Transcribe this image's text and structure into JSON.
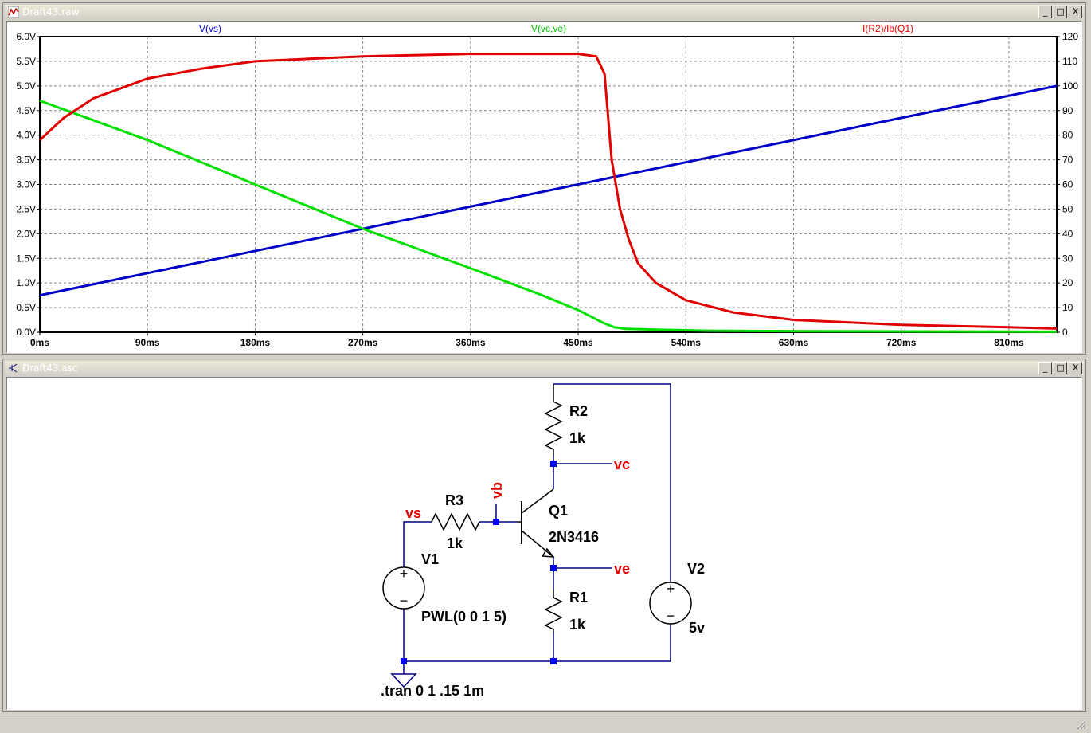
{
  "plot_window": {
    "title": "Draft43.raw",
    "icon": "waveform-icon",
    "controls": {
      "minimize": "_",
      "maximize": "□",
      "close": "X"
    },
    "traces": [
      {
        "label": "V(vs)",
        "color": "#0000c8"
      },
      {
        "label": "V(vc,ve)",
        "color": "#00e000"
      },
      {
        "label": "I(R2)/Ib(Q1)",
        "color": "#e00000"
      }
    ]
  },
  "chart_data": {
    "type": "line",
    "x_unit": "ms",
    "xlim": [
      0,
      850
    ],
    "x_ticks": [
      "0ms",
      "90ms",
      "180ms",
      "270ms",
      "360ms",
      "450ms",
      "540ms",
      "630ms",
      "720ms",
      "810ms"
    ],
    "y_left_ticks": [
      "0.0V",
      "0.5V",
      "1.0V",
      "1.5V",
      "2.0V",
      "2.5V",
      "3.0V",
      "3.5V",
      "4.0V",
      "4.5V",
      "5.0V",
      "5.5V",
      "6.0V"
    ],
    "y_left_lim": [
      0,
      6
    ],
    "y_right_ticks": [
      "0",
      "10",
      "20",
      "30",
      "40",
      "50",
      "60",
      "70",
      "80",
      "90",
      "100",
      "110",
      "120"
    ],
    "y_right_lim": [
      0,
      120
    ],
    "grid": true,
    "series": [
      {
        "name": "V(vs)",
        "axis": "left",
        "color": "#0000c8",
        "x": [
          0,
          850
        ],
        "y": [
          0.75,
          5.0
        ]
      },
      {
        "name": "V(vc,ve)",
        "axis": "left",
        "color": "#00e000",
        "x": [
          0,
          90,
          180,
          270,
          360,
          420,
          450,
          470,
          480,
          490,
          520,
          560,
          650,
          850
        ],
        "y": [
          4.7,
          3.9,
          3.0,
          2.1,
          1.3,
          0.75,
          0.45,
          0.2,
          0.1,
          0.07,
          0.05,
          0.03,
          0.02,
          0.01
        ]
      },
      {
        "name": "I(R2)/Ib(Q1)",
        "axis": "right",
        "color": "#e00000",
        "x": [
          0,
          20,
          45,
          90,
          135,
          180,
          225,
          270,
          360,
          450,
          465,
          472,
          478,
          485,
          492,
          500,
          515,
          540,
          580,
          630,
          720,
          810,
          850
        ],
        "y": [
          78,
          87,
          95,
          103,
          107,
          110,
          111,
          112,
          113,
          113,
          112,
          105,
          70,
          50,
          38,
          28,
          20,
          13,
          8,
          5,
          3,
          2,
          1.5
        ]
      }
    ]
  },
  "schematic_window": {
    "title": "Draft43.asc",
    "icon": "schematic-icon",
    "controls": {
      "minimize": "_",
      "maximize": "□",
      "close": "X"
    },
    "components": {
      "r2": {
        "name": "R2",
        "value": "1k"
      },
      "r3": {
        "name": "R3",
        "value": "1k"
      },
      "r1": {
        "name": "R1",
        "value": "1k"
      },
      "q1": {
        "name": "Q1",
        "value": "2N3416"
      },
      "v1": {
        "name": "V1",
        "value": "PWL(0 0 1 5)"
      },
      "v2": {
        "name": "V2",
        "value": "5v"
      }
    },
    "nets": {
      "vs": "vs",
      "vb": "vb",
      "vc": "vc",
      "ve": "ve"
    },
    "directive": ".tran 0 1 .15 1m",
    "wire_color": "#000080",
    "component_color": "#000000",
    "net_label_color": "#e00000",
    "junction_color": "#0000ff"
  }
}
